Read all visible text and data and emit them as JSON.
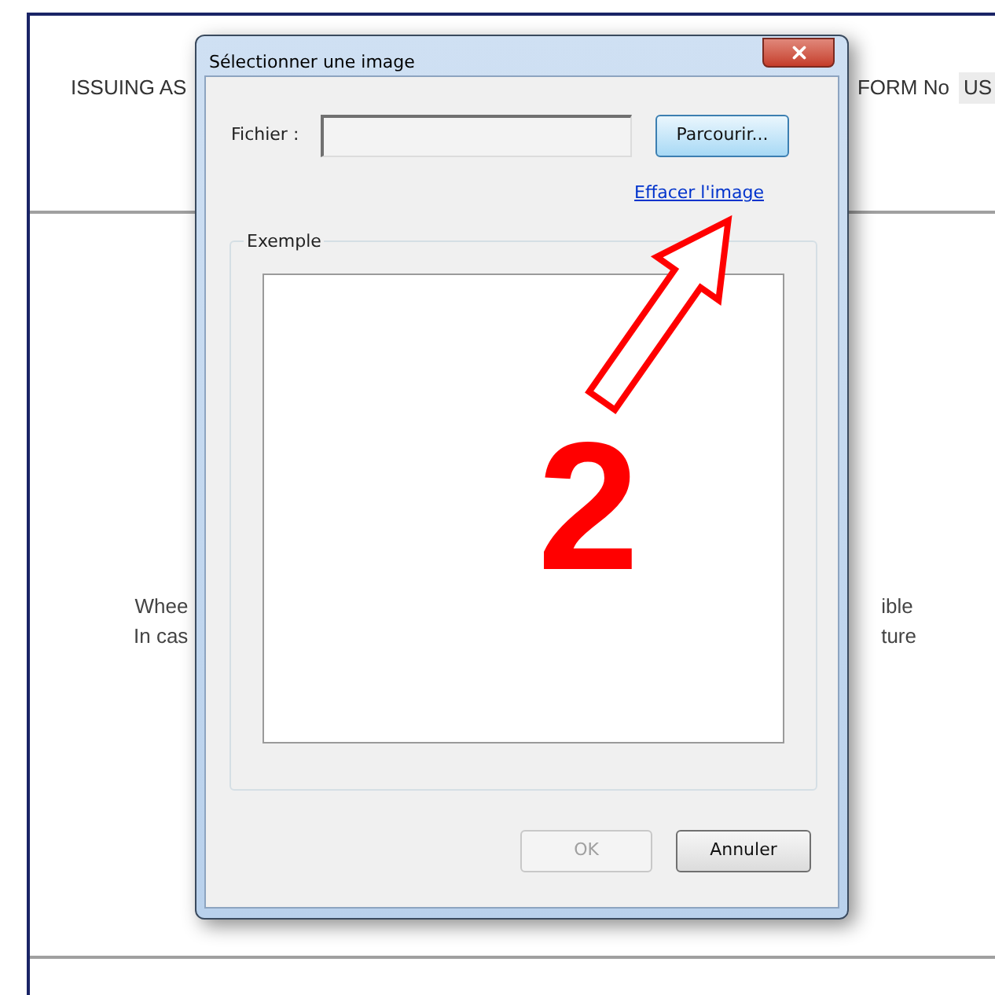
{
  "document": {
    "header_left": "ISSUING AS",
    "header_right_label": "FORM No",
    "header_right_value": "US",
    "left_lines": [
      "Whee",
      "In cas"
    ],
    "right_lines": [
      "ible",
      "ture"
    ]
  },
  "dialog": {
    "title": "Sélectionner une image",
    "file_label": "Fichier :",
    "browse_button": "Parcourir...",
    "clear_link": "Effacer l'image",
    "group_label": "Exemple",
    "buttons": [
      {
        "label": "OK",
        "disabled": true
      },
      {
        "label": "Annuler",
        "disabled": false
      }
    ]
  },
  "annotation": {
    "number": "2"
  }
}
